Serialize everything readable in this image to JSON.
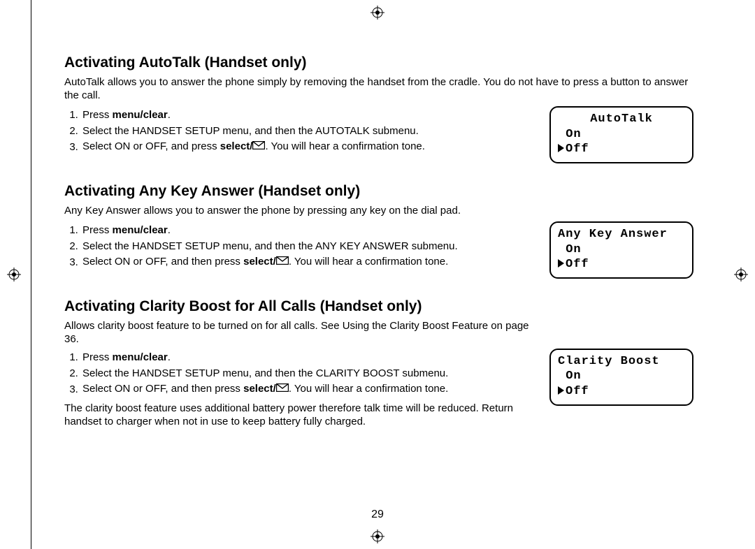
{
  "page_number": "29",
  "sections": [
    {
      "heading": "Activating AutoTalk (Handset only)",
      "intro": "AutoTalk allows you to answer the phone simply by removing the handset from the cradle. You do not have to press a button to answer the call.",
      "steps": {
        "s1_a": "Press ",
        "s1_b": "menu/clear",
        "s1_c": ".",
        "s2": "Select the HANDSET SETUP menu, and then the AUTOTALK submenu.",
        "s3_a": "Select ON or OFF, and press ",
        "s3_b": "select/",
        "s3_c": ". You will hear a confirmation tone."
      },
      "screen": {
        "title": "AutoTalk",
        "opt1": " On",
        "opt2": "Off"
      }
    },
    {
      "heading": "Activating Any Key Answer (Handset only)",
      "intro": "Any Key Answer allows you to answer the phone by pressing any key on the dial pad.",
      "steps": {
        "s1_a": "Press ",
        "s1_b": "menu/clear",
        "s1_c": ".",
        "s2": "Select the HANDSET SETUP menu, and then the ANY KEY ANSWER submenu.",
        "s3_a": "Select ON or OFF, and then press ",
        "s3_b": "select/",
        "s3_c": ". You will hear a confirmation tone."
      },
      "screen": {
        "title": "Any Key Answer",
        "opt1": " On",
        "opt2": "Off"
      }
    },
    {
      "heading": "Activating Clarity Boost for All Calls (Handset only)",
      "intro": "Allows clarity boost feature to be turned on for all calls. See Using the Clarity Boost Feature on page 36.",
      "steps": {
        "s1_a": "Press ",
        "s1_b": "menu/clear",
        "s1_c": ".",
        "s2": "Select the HANDSET SETUP menu, and then the CLARITY BOOST submenu.",
        "s3_a": "Select ON or OFF, and then press ",
        "s3_b": "select/",
        "s3_c": ". You will hear a confirmation tone."
      },
      "note": "The clarity boost feature uses additional battery power therefore talk time will be reduced. Return handset to charger when not in use to keep battery fully charged.",
      "screen": {
        "title": "Clarity Boost",
        "opt1": " On",
        "opt2": "Off"
      }
    }
  ]
}
